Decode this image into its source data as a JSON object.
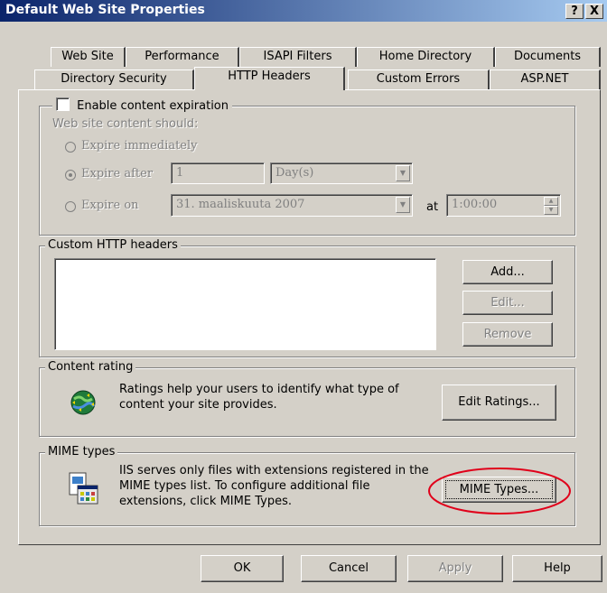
{
  "window": {
    "title": "Default Web Site Properties",
    "help_button": "?",
    "close_button": "X"
  },
  "tabs_row1": [
    "Web Site",
    "Performance",
    "ISAPI Filters",
    "Home Directory",
    "Documents"
  ],
  "tabs_row2": [
    "Directory Security",
    "HTTP Headers",
    "Custom Errors",
    "ASP.NET"
  ],
  "active_tab": "HTTP Headers",
  "expiration": {
    "checkbox_label": "Enable content expiration",
    "checked": false,
    "sublabel": "Web site content should:",
    "expire_immediately": "Expire immediately",
    "expire_after": "Expire after",
    "expire_after_value": "1",
    "expire_after_unit": "Day(s)",
    "expire_on": "Expire on",
    "expire_on_date": "31. maaliskuuta 2007",
    "at_label": "at",
    "expire_on_time": "1:00:00",
    "selected_option": "Expire after"
  },
  "custom_headers": {
    "label": "Custom HTTP headers",
    "add": "Add...",
    "edit": "Edit...",
    "remove": "Remove"
  },
  "content_rating": {
    "label": "Content rating",
    "text": "Ratings help your users to identify what type of content your site provides.",
    "button": "Edit Ratings..."
  },
  "mime": {
    "label": "MIME types",
    "text": "IIS serves only files with extensions registered in the MIME types list. To configure additional file extensions, click MIME Types.",
    "button": "MIME Types..."
  },
  "footer": {
    "ok": "OK",
    "cancel": "Cancel",
    "apply": "Apply",
    "help": "Help"
  },
  "colors": {
    "dialog_bg": "#d4d0c8",
    "titlebar_start": "#0a246a",
    "titlebar_end": "#a6caf0",
    "annotation_red": "#e0001a"
  }
}
